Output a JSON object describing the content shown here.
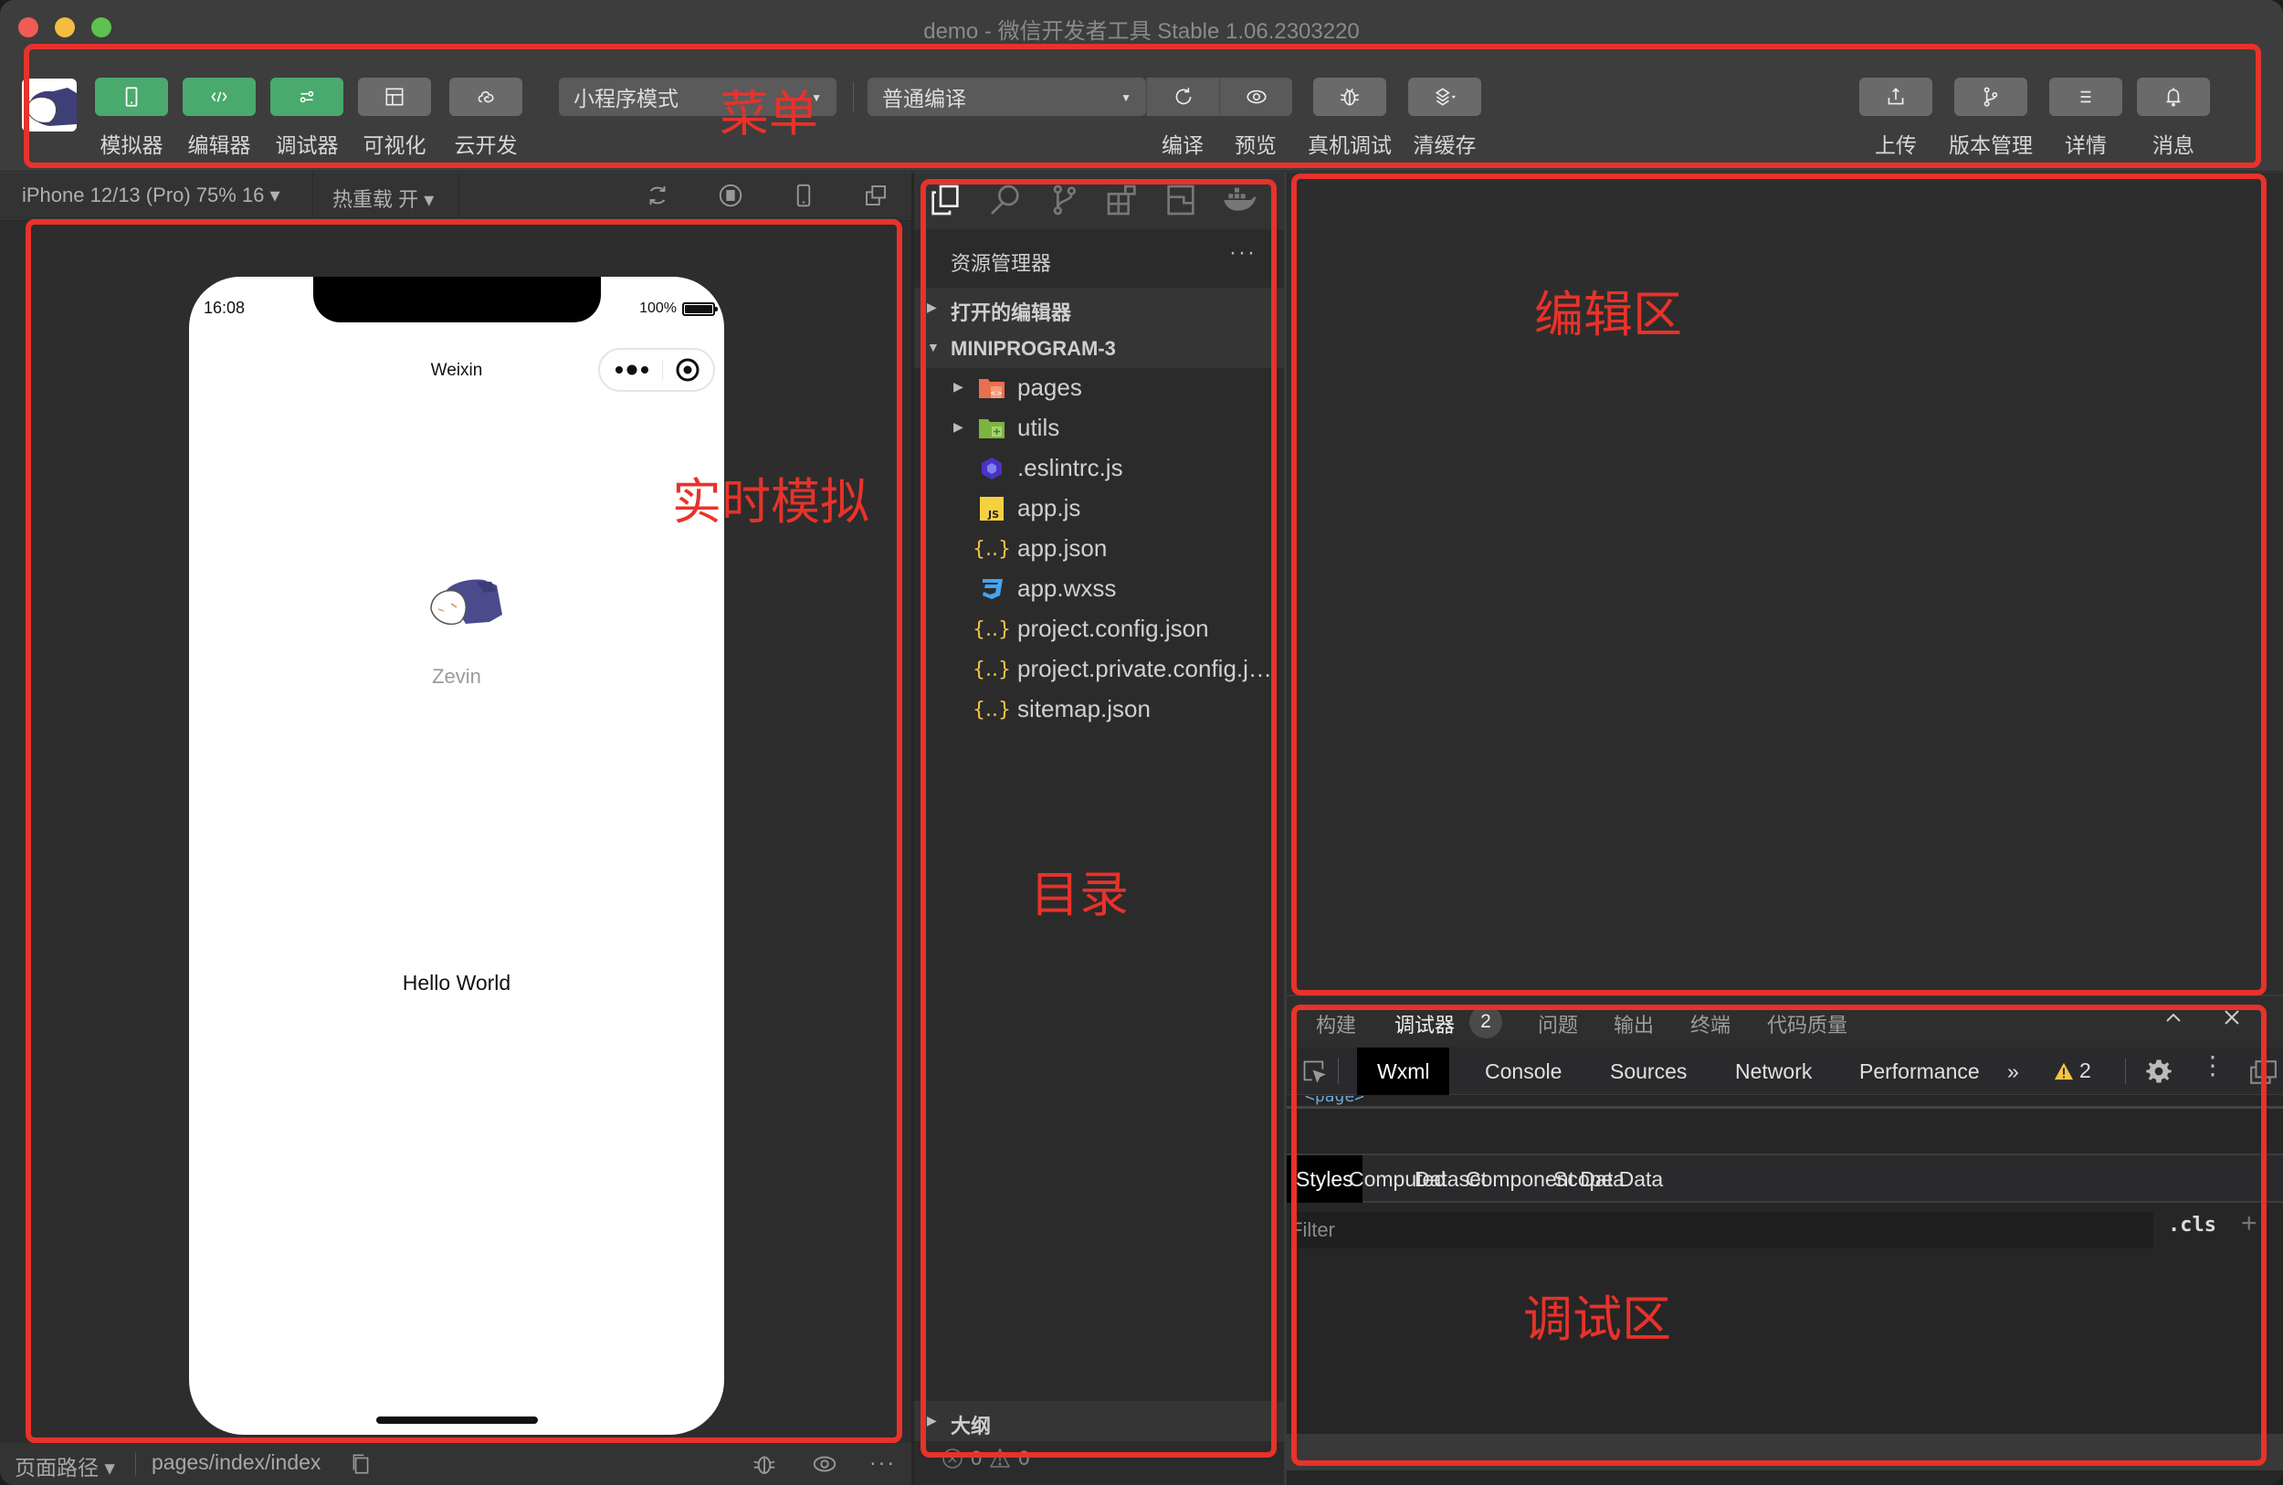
{
  "window": {
    "title": "demo - 微信开发者工具 Stable 1.06.2303220"
  },
  "toolbar": {
    "left_buttons": [
      {
        "label": "模拟器",
        "icon": "phone-icon",
        "active": true
      },
      {
        "label": "编辑器",
        "icon": "code-icon",
        "active": true
      },
      {
        "label": "调试器",
        "icon": "sliders-icon",
        "active": true
      },
      {
        "label": "可视化",
        "icon": "layout-icon",
        "active": false
      },
      {
        "label": "云开发",
        "icon": "cloud-icon",
        "active": false
      }
    ],
    "mode_select": "小程序模式",
    "compile_select": "普通编译",
    "center_buttons": [
      {
        "label": "编译",
        "icon": "refresh-icon"
      },
      {
        "label": "预览",
        "icon": "eye-icon"
      },
      {
        "label": "真机调试",
        "icon": "bug-icon"
      },
      {
        "label": "清缓存",
        "icon": "layers-icon"
      }
    ],
    "right_buttons": [
      {
        "label": "上传",
        "icon": "upload-icon"
      },
      {
        "label": "版本管理",
        "icon": "branch-icon"
      },
      {
        "label": "详情",
        "icon": "menu-icon"
      },
      {
        "label": "消息",
        "icon": "bell-icon"
      }
    ]
  },
  "simulator": {
    "device_select": "iPhone 12/13 (Pro) 75% 16 ▾",
    "hot_reload": "热重载 开 ▾",
    "phone": {
      "time": "16:08",
      "battery": "100%",
      "battery_level": 1.0,
      "nav_title": "Weixin",
      "user_name": "Zevin",
      "body_text": "Hello World"
    },
    "status": {
      "page_path_label": "页面路径 ▾",
      "page_path": "pages/index/index"
    }
  },
  "explorer": {
    "title": "资源管理器",
    "more": "···",
    "open_editors": "打开的编辑器",
    "project": "MINIPROGRAM-3",
    "files": [
      {
        "name": "pages",
        "type": "folder",
        "icon": "folder-pages-icon",
        "color": "#e8704e"
      },
      {
        "name": "utils",
        "type": "folder",
        "icon": "folder-utils-icon",
        "color": "#7cb342"
      },
      {
        "name": ".eslintrc.js",
        "type": "file",
        "icon": "eslint-icon",
        "color": "#4b32c3"
      },
      {
        "name": "app.js",
        "type": "file",
        "icon": "js-icon",
        "color": "#f5d142"
      },
      {
        "name": "app.json",
        "type": "file",
        "icon": "json-icon",
        "color": "#f5c542"
      },
      {
        "name": "app.wxss",
        "type": "file",
        "icon": "css-icon",
        "color": "#42a5f5"
      },
      {
        "name": "project.config.json",
        "type": "file",
        "icon": "json-icon",
        "color": "#f5c542"
      },
      {
        "name": "project.private.config.json",
        "type": "file",
        "icon": "json-icon",
        "color": "#f5c542"
      },
      {
        "name": "sitemap.json",
        "type": "file",
        "icon": "json-icon",
        "color": "#f5c542"
      }
    ],
    "outline": "大纲",
    "errors": "0",
    "warnings": "0"
  },
  "debugger": {
    "tabs": [
      "构建",
      "调试器",
      "问题",
      "输出",
      "终端",
      "代码质量"
    ],
    "active_tab": "调试器",
    "debugger_badge": "2",
    "devtools_tabs": [
      "Wxml",
      "Console",
      "Sources",
      "Network",
      "Performance"
    ],
    "more_tabs": "»",
    "warning_count": "2",
    "dom_snippet": "<page>",
    "style_tabs": [
      "Styles",
      "Computed",
      "Dataset",
      "Component Data",
      "Scope Data"
    ],
    "filter_placeholder": "Filter",
    "cls_label": ".cls",
    "plus_label": "+"
  },
  "annotations": {
    "menu": "菜单",
    "simulator": "实时模拟",
    "directory": "目录",
    "editor": "编辑区",
    "debugger": "调试区",
    "color": "#e8322a"
  }
}
